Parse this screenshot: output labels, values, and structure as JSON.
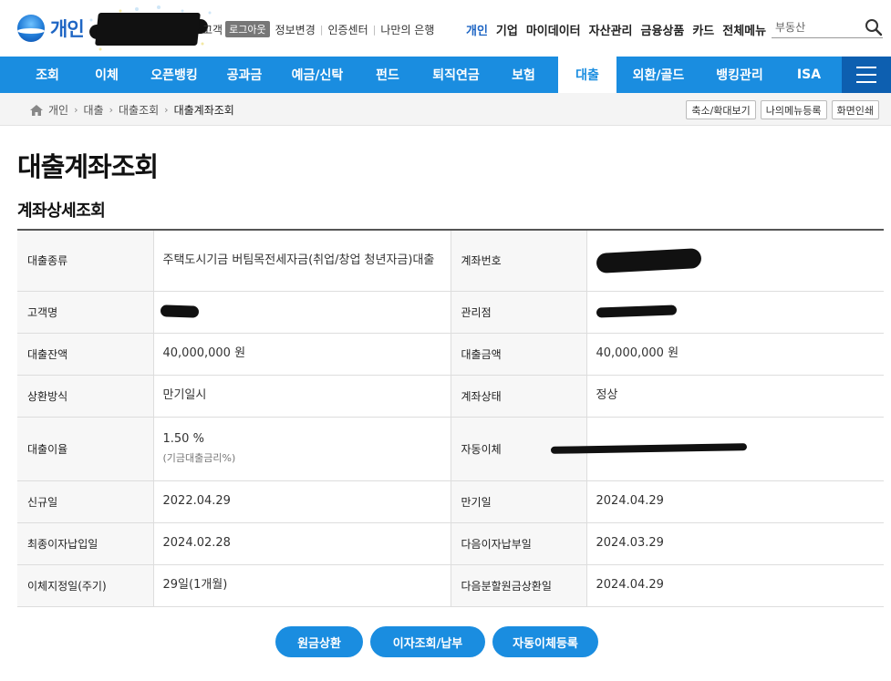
{
  "header": {
    "brand": "개인",
    "util_links": {
      "logout": "로그아웃",
      "profile": "정보변경",
      "cert": "인증센터",
      "mybank": "나만의 은행"
    },
    "util_partial": "고객",
    "main_links": [
      "개인",
      "기업",
      "마이데이터",
      "자산관리",
      "금융상품",
      "카드",
      "전체메뉴"
    ],
    "search_placeholder": "부동산"
  },
  "gnb": {
    "items": [
      "조회",
      "이체",
      "오픈뱅킹",
      "공과금",
      "예금/신탁",
      "펀드",
      "퇴직연금",
      "보험",
      "대출",
      "외환/골드",
      "뱅킹관리",
      "ISA"
    ],
    "active": "대출"
  },
  "breadcrumb": {
    "items": [
      "개인",
      "대출",
      "대출조회",
      "대출계좌조회"
    ],
    "buttons": [
      "축소/확대보기",
      "나의메뉴등록",
      "화면인쇄"
    ]
  },
  "page_title": "대출계좌조회",
  "section_title": "계좌상세조회",
  "details": {
    "loan_type": {
      "label": "대출종류",
      "value": "주택도시기금 버팀목전세자금(취업/창업 청년자금)대출"
    },
    "account_no": {
      "label": "계좌번호"
    },
    "customer": {
      "label": "고객명"
    },
    "branch": {
      "label": "관리점"
    },
    "balance": {
      "label": "대출잔액",
      "value": "40,000,000 원"
    },
    "amount": {
      "label": "대출금액",
      "value": "40,000,000 원"
    },
    "repay_method": {
      "label": "상환방식",
      "value": "만기일시"
    },
    "status": {
      "label": "계좌상태",
      "value": "정상"
    },
    "rate": {
      "label": "대출이율",
      "value": "1.50 %",
      "note": "(기금대출금리%)"
    },
    "auto_transfer": {
      "label": "자동이체"
    },
    "open_date": {
      "label": "신규일",
      "value": "2022.04.29"
    },
    "maturity": {
      "label": "만기일",
      "value": "2024.04.29"
    },
    "last_interest": {
      "label": "최종이자납입일",
      "value": "2024.02.28"
    },
    "next_interest": {
      "label": "다음이자납부일",
      "value": "2024.03.29"
    },
    "transfer_day": {
      "label": "이체지정일(주기)",
      "value": "29일(1개월)"
    },
    "next_principal": {
      "label": "다음분할원금상환일",
      "value": "2024.04.29"
    }
  },
  "actions": {
    "repay": "원금상환",
    "interest": "이자조회/납부",
    "autopay": "자동이체등록"
  },
  "colors": {
    "primary": "#1a8de0",
    "brand": "#1f66c4",
    "menu_dark": "#0d5fb0"
  }
}
